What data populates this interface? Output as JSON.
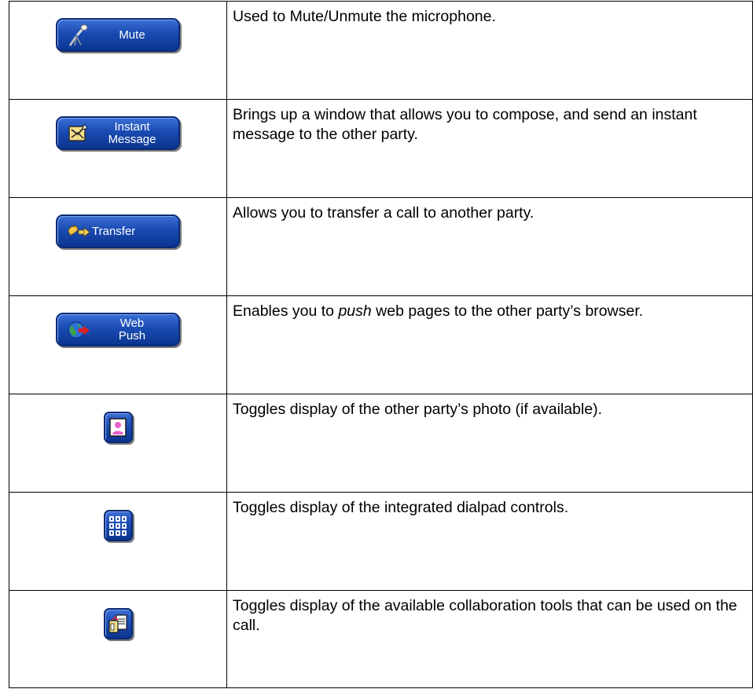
{
  "rows": [
    {
      "icon": "microphone-icon",
      "button_label": "Mute",
      "description": "Used to Mute/Unmute the microphone."
    },
    {
      "icon": "instant-message-icon",
      "button_label_line1": "Instant",
      "button_label_line2": "Message",
      "description": "Brings up a window that allows you to compose, and send an instant message to the other party."
    },
    {
      "icon": "transfer-hand-icon",
      "button_label": "Transfer",
      "description": "Allows you to transfer a call to another party."
    },
    {
      "icon": "globe-arrow-icon",
      "button_label_line1": "Web",
      "button_label_line2": "Push",
      "description_before": "Enables you to ",
      "description_em": "push",
      "description_after": " web pages to the other party’s browser."
    },
    {
      "icon": "person-photo-icon",
      "description": "Toggles display of the other party’s photo (if available)."
    },
    {
      "icon": "dialpad-icon",
      "description": "Toggles display of the integrated dialpad controls."
    },
    {
      "icon": "collaboration-tools-icon",
      "description": "Toggles display of the available collaboration tools that can be used on the call."
    }
  ]
}
